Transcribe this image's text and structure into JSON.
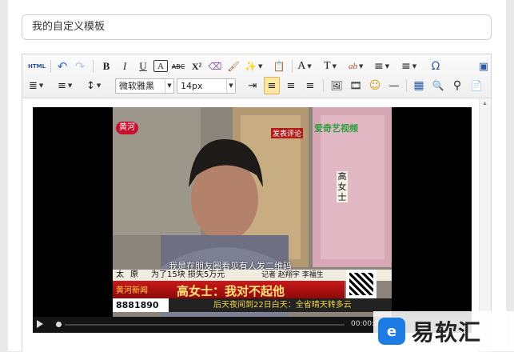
{
  "form": {
    "title_value": "我的自定义模板"
  },
  "toolbar": {
    "row1": [
      {
        "name": "html-source-button",
        "label": "HTML"
      },
      {
        "name": "undo-icon",
        "label": "↶"
      },
      {
        "name": "redo-icon",
        "label": "↷"
      },
      {
        "name": "bold-button",
        "label": "B"
      },
      {
        "name": "italic-button",
        "label": "I"
      },
      {
        "name": "underline-button",
        "label": "U"
      },
      {
        "name": "font-border-button",
        "label": "A"
      },
      {
        "name": "strikethrough-button",
        "label": "ABC"
      },
      {
        "name": "superscript-button",
        "label": "X²"
      },
      {
        "name": "eraser-icon",
        "label": "⌫"
      },
      {
        "name": "format-painter-icon",
        "label": "🖌"
      },
      {
        "name": "auto-format-icon",
        "label": "✨"
      },
      {
        "name": "paste-plain-icon",
        "label": "📋"
      },
      {
        "name": "font-color-button",
        "label": "A"
      },
      {
        "name": "background-color-button",
        "label": "T"
      },
      {
        "name": "spellcheck-button",
        "label": "ab"
      },
      {
        "name": "ordered-list-button",
        "label": "≡"
      },
      {
        "name": "unordered-list-button",
        "label": "≡"
      },
      {
        "name": "special-char-button",
        "label": "Ω"
      },
      {
        "name": "preview-icon",
        "label": "▣"
      }
    ],
    "font_family": "微软雅黑",
    "font_size": "14px",
    "row2_icons": [
      {
        "name": "paragraph-spacing-icon",
        "label": "≣"
      },
      {
        "name": "row-spacing-icon",
        "label": "≡"
      },
      {
        "name": "line-height-icon",
        "label": "↕"
      },
      {
        "name": "indent-icon",
        "label": "⇥"
      },
      {
        "name": "align-left-icon",
        "label": "≡"
      },
      {
        "name": "align-center-icon",
        "label": "≡"
      },
      {
        "name": "align-right-icon",
        "label": "≡"
      },
      {
        "name": "insert-image-icon",
        "label": "🖼"
      },
      {
        "name": "insert-video-icon",
        "label": "🎞"
      },
      {
        "name": "emoji-icon",
        "label": "☺"
      },
      {
        "name": "horizontal-rule-icon",
        "label": "—"
      },
      {
        "name": "insert-table-icon",
        "label": "▦"
      },
      {
        "name": "search-replace-icon",
        "label": "🔍"
      },
      {
        "name": "find-icon",
        "label": "⚲"
      },
      {
        "name": "template-icon",
        "label": "📄"
      }
    ]
  },
  "video": {
    "channel_logo_text": "黄河",
    "corner_tag": "发表评论",
    "corner_brand": "爱奇艺视频",
    "side_caption": "高女士",
    "subtitle": "我是在朋友圈看见有人发二维码",
    "news_location_1": "太",
    "news_location_2": "原",
    "news_headline_small": "为了15块 损失5万元",
    "reporter_credit": "记者 赵翔宇 李福生",
    "program_tag": "黄河新闻",
    "main_headline": "高女士：我对不起他",
    "hotline": "8881890",
    "ticker": "后天夜间到22日白天：全省晴天转多云",
    "time_display": "00:00:0"
  },
  "watermark": {
    "text": "易软汇",
    "logo_glyph": "e"
  }
}
